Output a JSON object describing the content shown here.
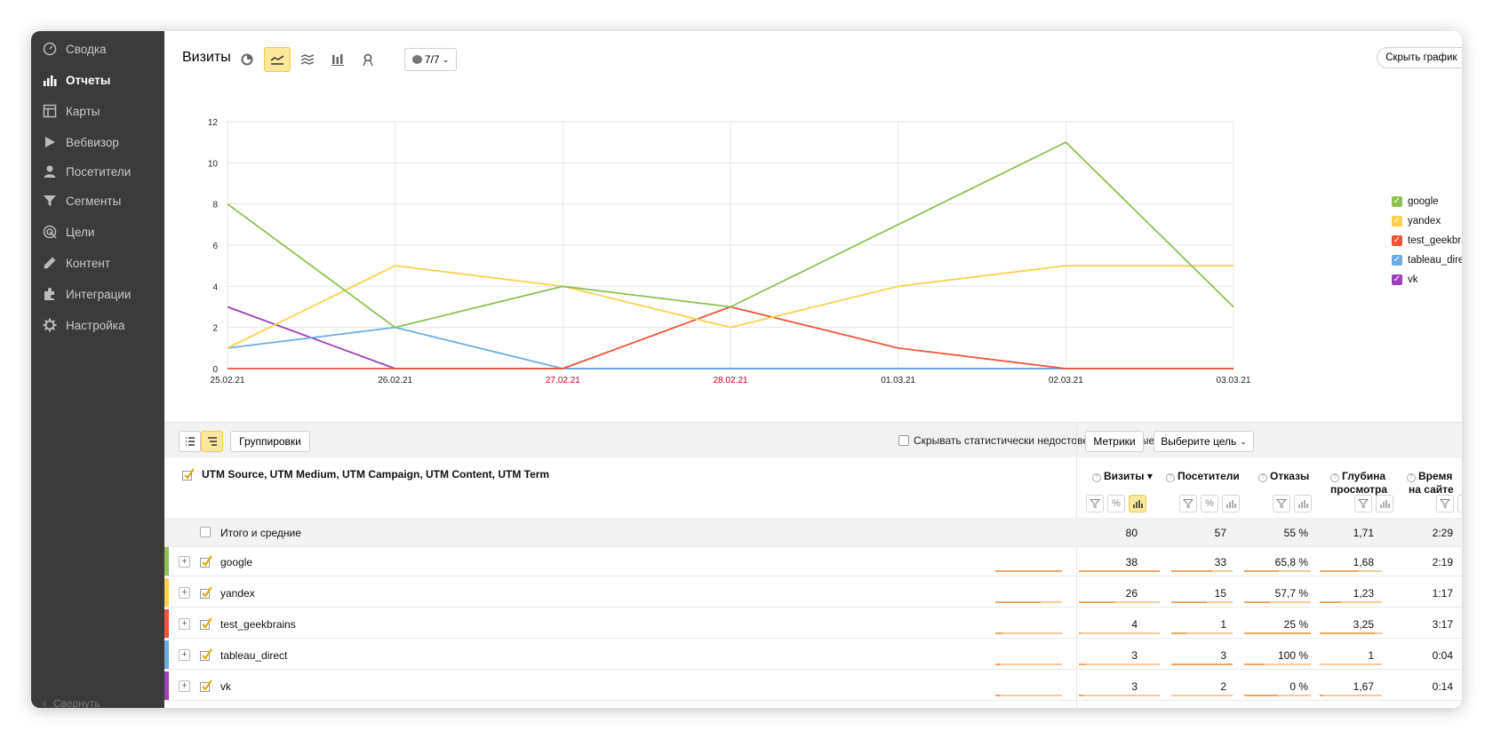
{
  "sidebar": {
    "items": [
      {
        "label": "Сводка",
        "icon": "dashboard-icon"
      },
      {
        "label": "Отчеты",
        "icon": "bar-chart-icon",
        "active": true
      },
      {
        "label": "Карты",
        "icon": "map-layout-icon"
      },
      {
        "label": "Вебвизор",
        "icon": "play-icon"
      },
      {
        "label": "Посетители",
        "icon": "user-icon"
      },
      {
        "label": "Сегменты",
        "icon": "filter-icon"
      },
      {
        "label": "Цели",
        "icon": "target-icon"
      },
      {
        "label": "Контент",
        "icon": "pencil-icon"
      },
      {
        "label": "Интеграции",
        "icon": "puzzle-icon"
      },
      {
        "label": "Настройка",
        "icon": "gear-icon"
      }
    ],
    "collapse_label": "Свернуть"
  },
  "header": {
    "title": "Визиты",
    "series_selector": "7/7",
    "hide_chart": "Скрыть график"
  },
  "chart_data": {
    "type": "line",
    "x": [
      "25.02.21",
      "26.02.21",
      "27.02.21",
      "28.02.21",
      "01.03.21",
      "02.03.21",
      "03.03.21"
    ],
    "weekend_x": [
      "27.02.21",
      "28.02.21"
    ],
    "ylim": [
      0,
      12
    ],
    "yticks": [
      0,
      2,
      4,
      6,
      8,
      10,
      12
    ],
    "grid": true,
    "legend_position": "right",
    "series": [
      {
        "name": "google",
        "color": "#8dc153",
        "values": [
          8,
          2,
          4,
          3,
          7,
          11,
          3
        ]
      },
      {
        "name": "yandex",
        "color": "#fbd051",
        "values": [
          1,
          5,
          4,
          2,
          4,
          5,
          5
        ]
      },
      {
        "name": "test_geekbrains",
        "color": "#f0553a",
        "values": [
          0,
          0,
          0,
          3,
          1,
          0,
          0
        ]
      },
      {
        "name": "tableau_direct",
        "color": "#6aade4",
        "values": [
          1,
          2,
          0,
          0,
          0,
          0,
          0
        ]
      },
      {
        "name": "vk",
        "color": "#9c42b8",
        "values": [
          3,
          0,
          0,
          0,
          0,
          0,
          0
        ]
      }
    ]
  },
  "toolbar": {
    "groupings": "Группировки",
    "hide_unreliable": "Скрывать статистически недостоверные данные",
    "metrics": "Метрики",
    "goal": "Выберите цель"
  },
  "table": {
    "dimensions": "UTM Source, UTM Medium, UTM Campaign, UTM Content, UTM Term",
    "columns": [
      {
        "label": "Визиты ▾",
        "line2": ""
      },
      {
        "label": "Посетители",
        "line2": ""
      },
      {
        "label": "Отказы",
        "line2": ""
      },
      {
        "label": "Глубина",
        "line2": "просмотра"
      },
      {
        "label": "Время",
        "line2": "на сайте"
      }
    ],
    "total": {
      "label": "Итого и средние",
      "values": [
        "80",
        "57",
        "55 %",
        "1,71",
        "2:29"
      ]
    },
    "rows": [
      {
        "name": "google",
        "color": "#8dc153",
        "values": [
          "38",
          "33",
          "65,8 %",
          "1,68",
          "2:19"
        ],
        "fractions": [
          1.0,
          1.0,
          0.66,
          0.52,
          0.62
        ]
      },
      {
        "name": "yandex",
        "color": "#fbd051",
        "values": [
          "26",
          "15",
          "57,7 %",
          "1,23",
          "1:17"
        ],
        "fractions": [
          0.68,
          0.45,
          0.58,
          0.38,
          0.34
        ]
      },
      {
        "name": "test_geekbrains",
        "color": "#f0553a",
        "values": [
          "4",
          "1",
          "25 %",
          "3,25",
          "3:17"
        ],
        "fractions": [
          0.1,
          0.03,
          0.25,
          1.0,
          0.88
        ]
      },
      {
        "name": "tableau_direct",
        "color": "#6aade4",
        "values": [
          "3",
          "3",
          "100 %",
          "1",
          "0:04"
        ],
        "fractions": [
          0.08,
          0.09,
          1.0,
          0.31,
          0.02
        ]
      },
      {
        "name": "vk",
        "color": "#9c42b8",
        "values": [
          "3",
          "2",
          "0 %",
          "1,67",
          "0:14"
        ],
        "fractions": [
          0.08,
          0.06,
          0.0,
          0.51,
          0.06
        ]
      }
    ]
  }
}
